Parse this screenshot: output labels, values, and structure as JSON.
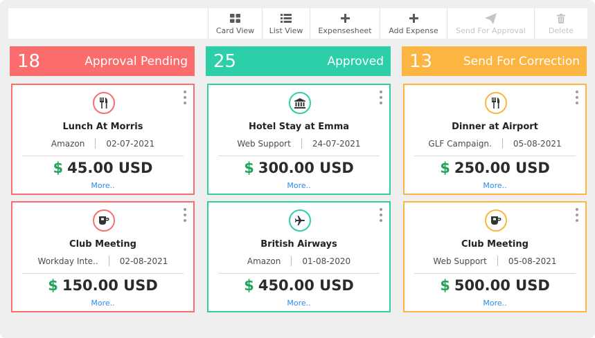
{
  "toolbar": {
    "items": [
      {
        "label": "Card View",
        "icon": "grid-icon",
        "enabled": true
      },
      {
        "label": "List View",
        "icon": "list-icon",
        "enabled": true
      },
      {
        "label": "Expensesheet",
        "icon": "plus-icon",
        "enabled": true
      },
      {
        "label": "Add Expense",
        "icon": "plus-icon",
        "enabled": true
      },
      {
        "label": "Send For Approval",
        "icon": "paper-plane-icon",
        "enabled": false
      },
      {
        "label": "Delete",
        "icon": "trash-icon",
        "enabled": false
      }
    ]
  },
  "colors": {
    "pending": "#fb6d6d",
    "approved": "#2ccfa7",
    "correction": "#fbb540",
    "amount_symbol": "#22a35a",
    "link": "#2c8ae8"
  },
  "columns": [
    {
      "count": "18",
      "title": "Approval Pending",
      "cards": [
        {
          "icon": "fork-knife-icon",
          "title": "Lunch At Morris",
          "project": "Amazon",
          "date": "02-07-2021",
          "currency_symbol": "$",
          "amount": "45.00 USD",
          "more": "More.."
        },
        {
          "icon": "coffee-cup-icon",
          "title": "Club Meeting",
          "project": "Workday Inte..",
          "date": "02-08-2021",
          "currency_symbol": "$",
          "amount": "150.00 USD",
          "more": "More.."
        }
      ]
    },
    {
      "count": "25",
      "title": "Approved",
      "cards": [
        {
          "icon": "bank-icon",
          "title": "Hotel Stay at Emma",
          "project": "Web Support",
          "date": "24-07-2021",
          "currency_symbol": "$",
          "amount": "300.00 USD",
          "more": "More.."
        },
        {
          "icon": "airplane-icon",
          "title": "British Airways",
          "project": "Amazon",
          "date": "01-08-2020",
          "currency_symbol": "$",
          "amount": "450.00 USD",
          "more": "More.."
        }
      ]
    },
    {
      "count": "13",
      "title": "Send For Correction",
      "cards": [
        {
          "icon": "fork-knife-icon",
          "title": "Dinner at Airport",
          "project": "GLF Campaign.",
          "date": "05-08-2021",
          "currency_symbol": "$",
          "amount": "250.00 USD",
          "more": "More.."
        },
        {
          "icon": "coffee-cup-icon",
          "title": "Club Meeting",
          "project": "Web Support",
          "date": "05-08-2021",
          "currency_symbol": "$",
          "amount": "500.00 USD",
          "more": "More.."
        }
      ]
    }
  ]
}
